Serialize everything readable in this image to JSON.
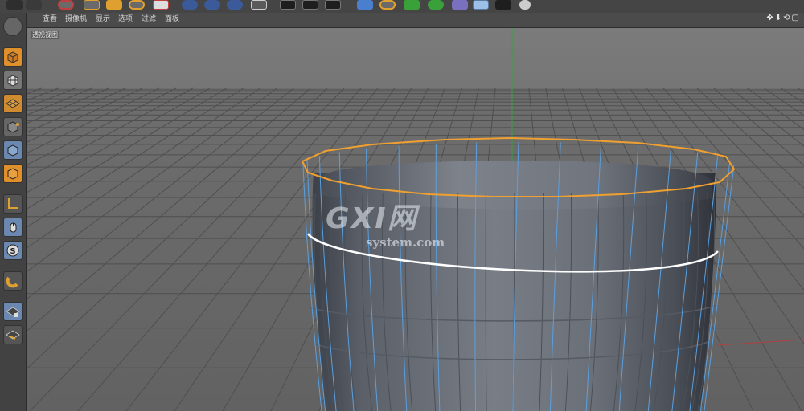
{
  "menu": {
    "items": [
      "查看",
      "摄像机",
      "显示",
      "选项",
      "过滤",
      "面板"
    ]
  },
  "viewport": {
    "label": "透视视图"
  },
  "nav_icons": [
    "✥",
    "⬇",
    "⟲",
    "▢"
  ],
  "watermark": {
    "title": "GXI网",
    "subtitle": "system.com"
  },
  "colors": {
    "accent_orange": "#f0a030",
    "selection_blue": "#5aa0e0",
    "axis_green": "#3aa03a",
    "grid_bg": "#6c6c6c"
  },
  "toolbar": {
    "icons": [
      "render-icon",
      "render-settings-icon",
      "undo-icon",
      "move-icon",
      "scale-icon",
      "rotate-icon",
      "transform-icon",
      "x-axis-icon",
      "y-axis-icon",
      "z-axis-icon",
      "coordinate-icon",
      "film-icon",
      "film-play-icon",
      "film-edit-icon",
      "cube-icon",
      "deformer-icon",
      "generator-icon",
      "mograph-icon",
      "tag-icon",
      "floor-icon",
      "camera-icon",
      "light-icon"
    ]
  }
}
